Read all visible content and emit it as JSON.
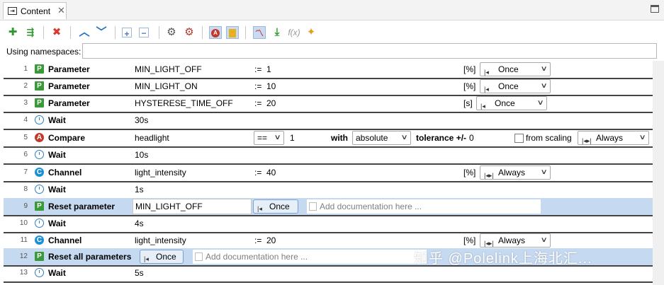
{
  "tab": {
    "label": "Content",
    "close": "✕"
  },
  "namespaces": {
    "label": "Using namespaces:",
    "value": ""
  },
  "toolbar": {
    "icons": [
      "add-icon",
      "add-step-icon",
      "delete-icon",
      "move-up-icon",
      "move-down-icon",
      "expand-icon",
      "collapse-icon",
      "settings-icon",
      "settings-red-icon",
      "a-toggle-icon",
      "doc-toggle-icon",
      "graph-icon",
      "download-icon",
      "function-icon",
      "magic-wand-icon"
    ]
  },
  "rows": [
    {
      "num": "1",
      "type": "Parameter",
      "name": "MIN_LIGHT_OFF",
      "assign": ":=",
      "value": "1",
      "unit": "[%]",
      "mode": "Once"
    },
    {
      "num": "2",
      "type": "Parameter",
      "name": "MIN_LIGHT_ON",
      "assign": ":=",
      "value": "10",
      "unit": "[%]",
      "mode": "Once"
    },
    {
      "num": "3",
      "type": "Parameter",
      "name": "HYSTERESE_TIME_OFF",
      "assign": ":=",
      "value": "20",
      "unit": "[s]",
      "mode": "Once"
    },
    {
      "num": "4",
      "type": "Wait",
      "name": "30s"
    },
    {
      "num": "5",
      "type": "Compare",
      "name": "headlight",
      "operator": "==",
      "value": "1",
      "with_label": "with",
      "with_mode": "absolute",
      "tolerance_label": "tolerance +/-",
      "tolerance": "0",
      "from_scaling": "from scaling",
      "mode": "Always"
    },
    {
      "num": "6",
      "type": "Wait",
      "name": "10s"
    },
    {
      "num": "7",
      "type": "Channel",
      "name": "light_intensity",
      "assign": ":=",
      "value": "40",
      "unit": "[%]",
      "mode": "Always"
    },
    {
      "num": "8",
      "type": "Wait",
      "name": "1s"
    },
    {
      "num": "9",
      "type": "Reset parameter",
      "name": "MIN_LIGHT_OFF",
      "mode": "Once",
      "doc": "Add documentation here ..."
    },
    {
      "num": "10",
      "type": "Wait",
      "name": "4s"
    },
    {
      "num": "11",
      "type": "Channel",
      "name": "light_intensity",
      "assign": ":=",
      "value": "20",
      "unit": "[%]",
      "mode": "Always"
    },
    {
      "num": "12",
      "type": "Reset all parameters",
      "mode": "Once",
      "doc": "Add documentation here ..."
    },
    {
      "num": "13",
      "type": "Wait",
      "name": "5s"
    }
  ],
  "watermark": "知乎 @Polelink上海北汇..."
}
